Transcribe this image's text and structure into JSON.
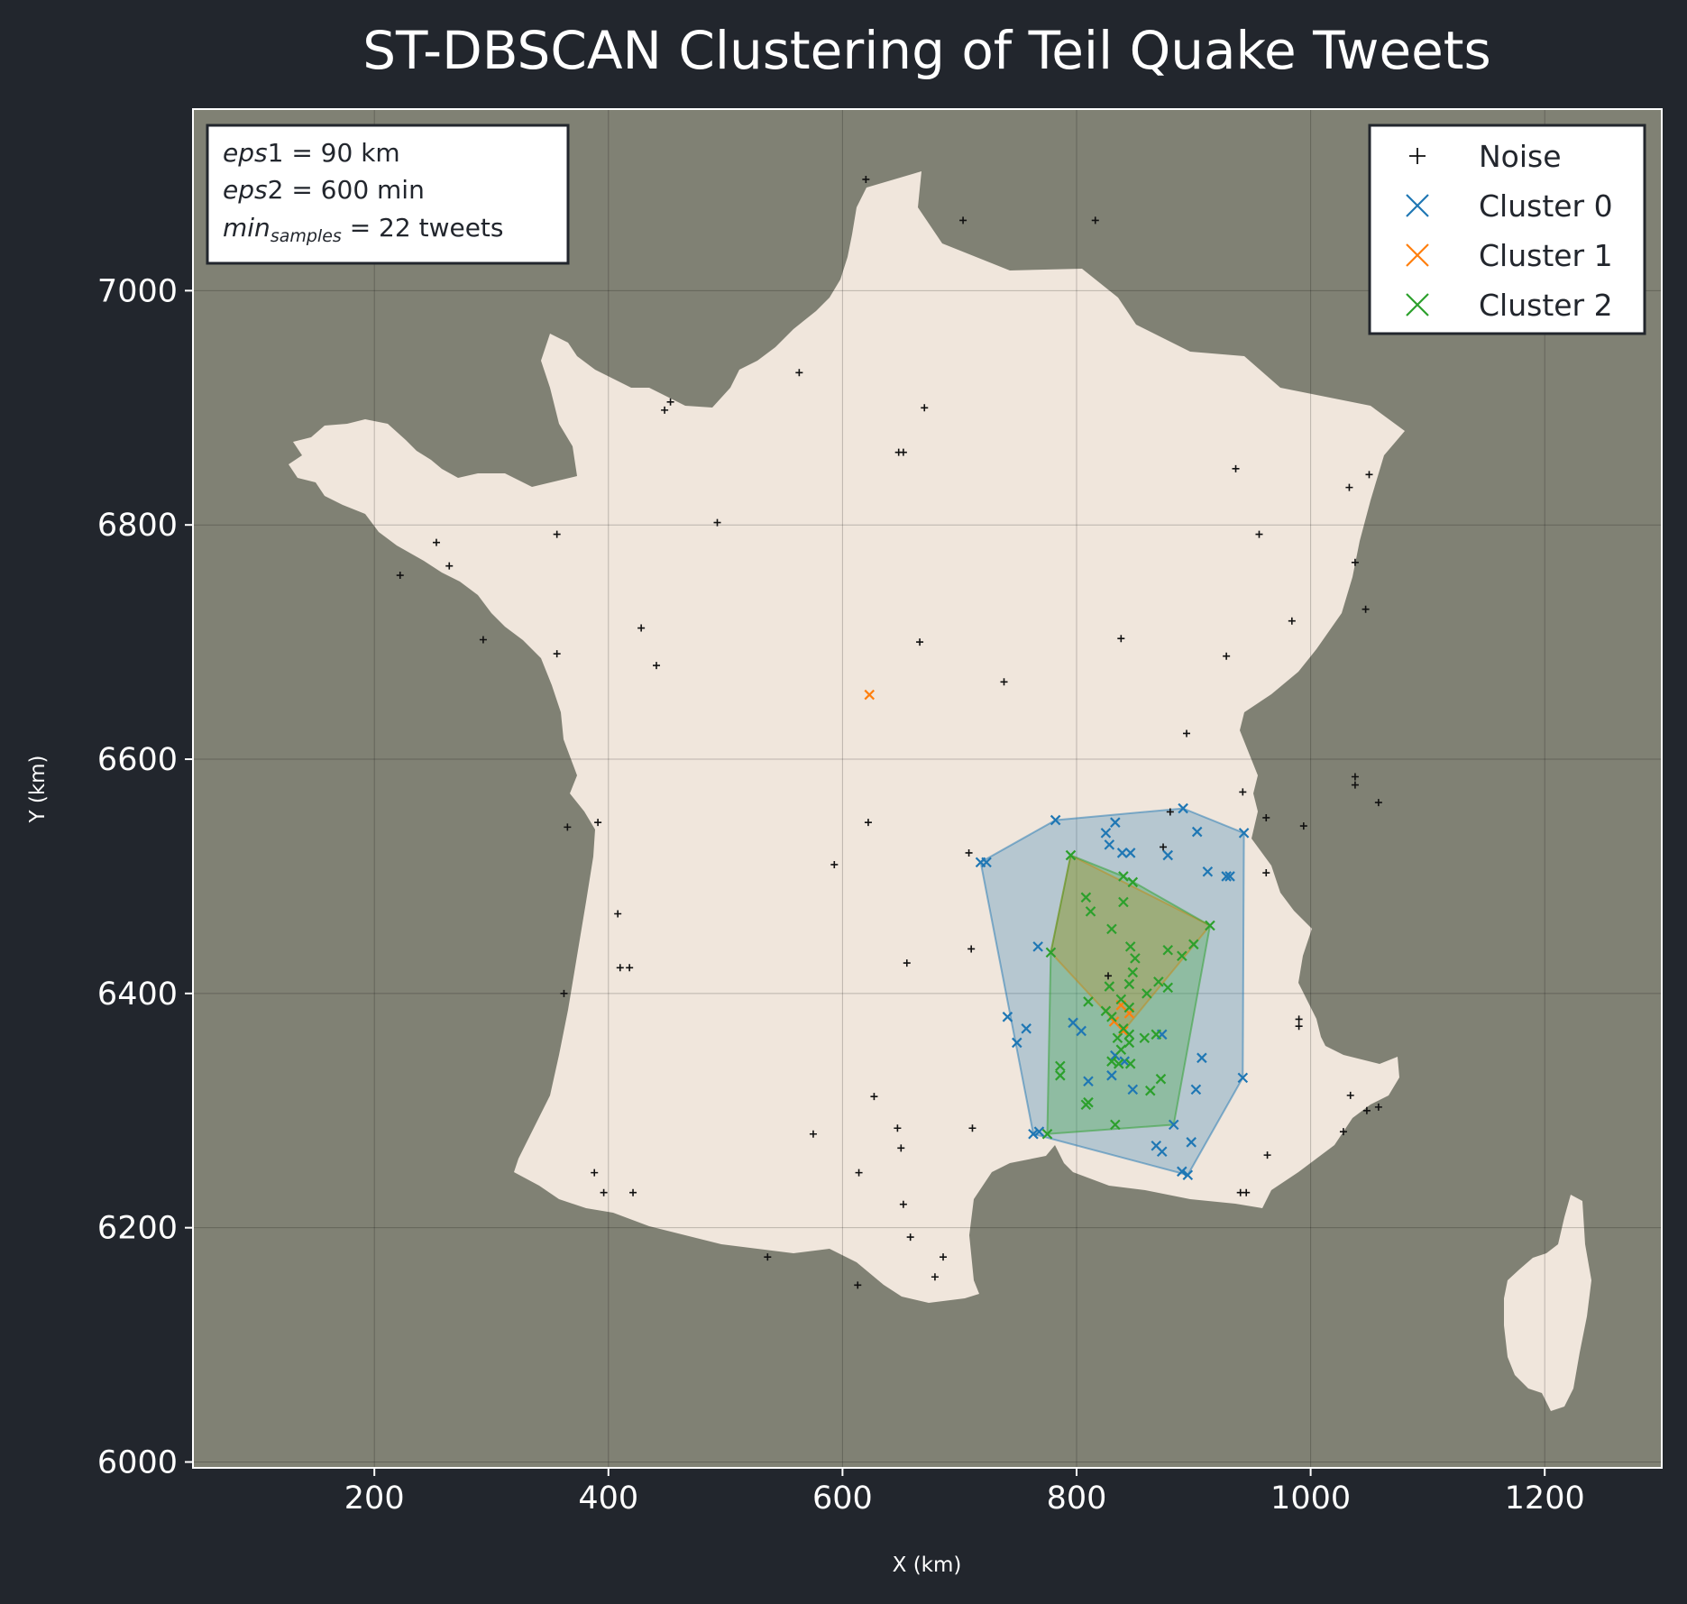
{
  "chart_data": {
    "type": "scatter",
    "title": "ST-DBSCAN Clustering of Teil Quake Tweets",
    "xlabel": "X (km)",
    "ylabel": "Y (km)",
    "xlim": [
      45,
      1300
    ],
    "ylim": [
      5995,
      7155
    ],
    "xticks": [
      200,
      400,
      600,
      800,
      1000,
      1200
    ],
    "yticks": [
      6000,
      6200,
      6400,
      6600,
      6800,
      7000
    ],
    "grid": true,
    "legend_position": "top-right",
    "annotation": {
      "line1": {
        "prefix": "eps",
        "main": "1",
        "value": " = 90 km"
      },
      "line2": {
        "prefix": "eps",
        "main": "2",
        "value": " = 600 min"
      },
      "line3": {
        "prefix": "min",
        "sub": "samples",
        "value": " = 22 tweets"
      }
    },
    "colors": {
      "figure_bg": "#22262d",
      "ocean": "#808174",
      "land": "#f0e6dc",
      "noise": "#111111",
      "cluster0": "#1f77b4",
      "cluster1": "#ff7f0e",
      "cluster2": "#2ca02c"
    },
    "series": [
      {
        "name": "Noise",
        "marker": "plus",
        "points": [
          [
            620,
            7095
          ],
          [
            703,
            7060
          ],
          [
            816,
            7060
          ],
          [
            563,
            6930
          ],
          [
            453,
            6905
          ],
          [
            448,
            6898
          ],
          [
            670,
            6900
          ],
          [
            648,
            6862
          ],
          [
            652,
            6862
          ],
          [
            936,
            6848
          ],
          [
            1050,
            6843
          ],
          [
            1033,
            6832
          ],
          [
            253,
            6785
          ],
          [
            356,
            6792
          ],
          [
            493,
            6802
          ],
          [
            956,
            6792
          ],
          [
            264,
            6765
          ],
          [
            1038,
            6768
          ],
          [
            222,
            6757
          ],
          [
            984,
            6718
          ],
          [
            1047,
            6728
          ],
          [
            428,
            6712
          ],
          [
            838,
            6703
          ],
          [
            666,
            6700
          ],
          [
            293,
            6702
          ],
          [
            356,
            6690
          ],
          [
            441,
            6680
          ],
          [
            928,
            6688
          ],
          [
            738,
            6666
          ],
          [
            894,
            6622
          ],
          [
            1038,
            6585
          ],
          [
            1038,
            6578
          ],
          [
            1058,
            6563
          ],
          [
            942,
            6572
          ],
          [
            962,
            6550
          ],
          [
            994,
            6543
          ],
          [
            880,
            6555
          ],
          [
            622,
            6546
          ],
          [
            365,
            6542
          ],
          [
            391,
            6546
          ],
          [
            708,
            6520
          ],
          [
            874,
            6525
          ],
          [
            593,
            6510
          ],
          [
            962,
            6503
          ],
          [
            408,
            6468
          ],
          [
            710,
            6438
          ],
          [
            655,
            6426
          ],
          [
            410,
            6422
          ],
          [
            418,
            6422
          ],
          [
            362,
            6400
          ],
          [
            827,
            6415
          ],
          [
            990,
            6378
          ],
          [
            990,
            6372
          ],
          [
            627,
            6312
          ],
          [
            1034,
            6313
          ],
          [
            1048,
            6300
          ],
          [
            1058,
            6303
          ],
          [
            711,
            6285
          ],
          [
            647,
            6285
          ],
          [
            650,
            6268
          ],
          [
            575,
            6280
          ],
          [
            1028,
            6282
          ],
          [
            963,
            6262
          ],
          [
            388,
            6247
          ],
          [
            614,
            6247
          ],
          [
            396,
            6230
          ],
          [
            421,
            6230
          ],
          [
            940,
            6230
          ],
          [
            945,
            6230
          ],
          [
            652,
            6220
          ],
          [
            658,
            6192
          ],
          [
            536,
            6175
          ],
          [
            686,
            6175
          ],
          [
            679,
            6158
          ],
          [
            613,
            6151
          ]
        ]
      },
      {
        "name": "Cluster 0",
        "marker": "x",
        "points": [
          [
            782,
            6548
          ],
          [
            833,
            6546
          ],
          [
            891,
            6558
          ],
          [
            825,
            6537
          ],
          [
            828,
            6527
          ],
          [
            839,
            6520
          ],
          [
            846,
            6520
          ],
          [
            878,
            6518
          ],
          [
            903,
            6538
          ],
          [
            943,
            6537
          ],
          [
            718,
            6512
          ],
          [
            723,
            6512
          ],
          [
            912,
            6504
          ],
          [
            928,
            6500
          ],
          [
            931,
            6500
          ],
          [
            767,
            6440
          ],
          [
            741,
            6380
          ],
          [
            757,
            6370
          ],
          [
            749,
            6358
          ],
          [
            797,
            6375
          ],
          [
            804,
            6368
          ],
          [
            833,
            6347
          ],
          [
            873,
            6365
          ],
          [
            841,
            6342
          ],
          [
            907,
            6345
          ],
          [
            942,
            6328
          ],
          [
            810,
            6325
          ],
          [
            830,
            6330
          ],
          [
            848,
            6318
          ],
          [
            902,
            6318
          ],
          [
            763,
            6280
          ],
          [
            768,
            6282
          ],
          [
            883,
            6288
          ],
          [
            898,
            6273
          ],
          [
            868,
            6270
          ],
          [
            873,
            6265
          ],
          [
            890,
            6248
          ],
          [
            895,
            6245
          ]
        ]
      },
      {
        "name": "Cluster 1",
        "marker": "x",
        "points": [
          [
            623,
            6655
          ],
          [
            838,
            6390
          ],
          [
            832,
            6376
          ],
          [
            845,
            6383
          ],
          [
            840,
            6368
          ]
        ]
      },
      {
        "name": "Cluster 2",
        "marker": "x",
        "points": [
          [
            795,
            6518
          ],
          [
            840,
            6500
          ],
          [
            808,
            6482
          ],
          [
            848,
            6495
          ],
          [
            840,
            6478
          ],
          [
            812,
            6470
          ],
          [
            830,
            6455
          ],
          [
            914,
            6458
          ],
          [
            846,
            6440
          ],
          [
            850,
            6430
          ],
          [
            878,
            6437
          ],
          [
            890,
            6432
          ],
          [
            900,
            6442
          ],
          [
            778,
            6435
          ],
          [
            848,
            6418
          ],
          [
            845,
            6408
          ],
          [
            828,
            6406
          ],
          [
            870,
            6410
          ],
          [
            878,
            6405
          ],
          [
            860,
            6400
          ],
          [
            810,
            6393
          ],
          [
            825,
            6385
          ],
          [
            838,
            6395
          ],
          [
            845,
            6388
          ],
          [
            830,
            6380
          ],
          [
            840,
            6370
          ],
          [
            845,
            6365
          ],
          [
            835,
            6362
          ],
          [
            858,
            6362
          ],
          [
            868,
            6365
          ],
          [
            845,
            6358
          ],
          [
            838,
            6352
          ],
          [
            830,
            6342
          ],
          [
            786,
            6338
          ],
          [
            786,
            6330
          ],
          [
            836,
            6340
          ],
          [
            846,
            6340
          ],
          [
            872,
            6327
          ],
          [
            863,
            6317
          ],
          [
            810,
            6307
          ],
          [
            808,
            6305
          ],
          [
            833,
            6288
          ],
          [
            775,
            6280
          ]
        ]
      }
    ],
    "hulls": [
      {
        "series": "Cluster 0",
        "points": [
          [
            718,
            6512
          ],
          [
            782,
            6548
          ],
          [
            891,
            6558
          ],
          [
            943,
            6537
          ],
          [
            942,
            6328
          ],
          [
            895,
            6245
          ],
          [
            763,
            6280
          ]
        ]
      },
      {
        "series": "Cluster 1",
        "points": [
          [
            795,
            6518
          ],
          [
            914,
            6458
          ],
          [
            840,
            6368
          ],
          [
            778,
            6435
          ]
        ]
      },
      {
        "series": "Cluster 2",
        "points": [
          [
            795,
            6518
          ],
          [
            840,
            6500
          ],
          [
            914,
            6458
          ],
          [
            883,
            6288
          ],
          [
            775,
            6280
          ],
          [
            778,
            6435
          ]
        ]
      }
    ]
  }
}
